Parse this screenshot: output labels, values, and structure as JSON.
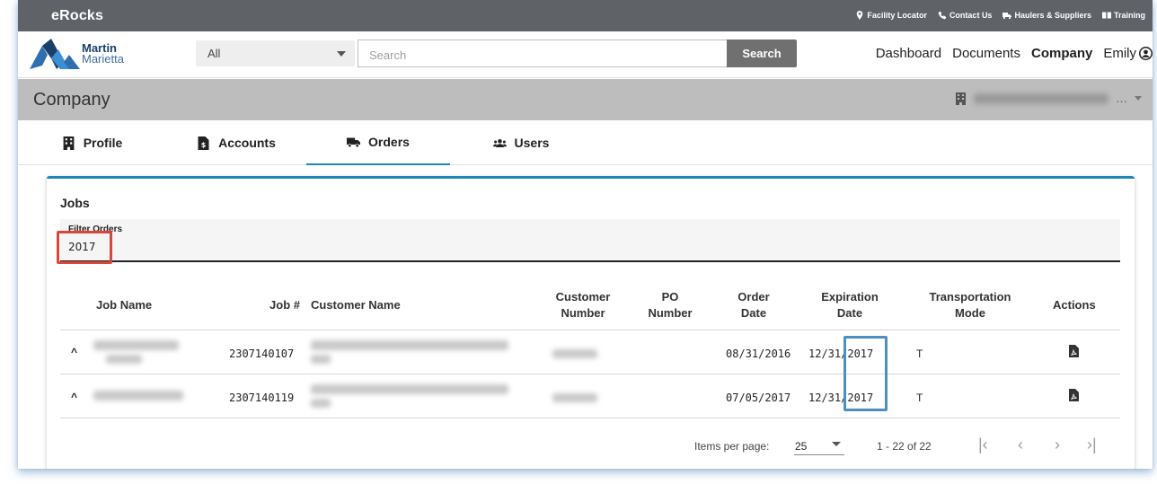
{
  "topbar": {
    "brand": "eRocks",
    "links": [
      "Facility Locator",
      "Contact Us",
      "Haulers & Suppliers",
      "Training"
    ]
  },
  "header": {
    "logo_line1": "Martin",
    "logo_line2": "Marietta",
    "select_value": "All",
    "search_placeholder": "Search",
    "search_button": "Search",
    "nav": [
      "Dashboard",
      "Documents",
      "Company",
      "Emily"
    ]
  },
  "company": {
    "title": "Company",
    "selector_suffix": "…"
  },
  "tabs": [
    {
      "label": "Profile",
      "icon": "building-icon"
    },
    {
      "label": "Accounts",
      "icon": "document-dollar-icon"
    },
    {
      "label": "Orders",
      "icon": "truck-icon"
    },
    {
      "label": "Users",
      "icon": "users-icon"
    }
  ],
  "active_tab": "Orders",
  "jobs": {
    "title": "Jobs",
    "filter_label": "Filter Orders",
    "filter_value": "2017",
    "columns": {
      "job_name": "Job Name",
      "job_number": "Job #",
      "customer_name": "Customer Name",
      "customer_number": [
        "Customer",
        "Number"
      ],
      "po_number": [
        "PO",
        "Number"
      ],
      "order_date": [
        "Order",
        "Date"
      ],
      "expiration_date": [
        "Expiration",
        "Date"
      ],
      "transportation_mode": [
        "Transportation",
        "Mode"
      ],
      "actions": "Actions"
    },
    "rows": [
      {
        "job_number": "2307140107",
        "order_date": "08/31/2016",
        "expiration_date": "12/31/2017",
        "transportation_mode": "T"
      },
      {
        "job_number": "2307140119",
        "order_date": "07/05/2017",
        "expiration_date": "12/31/2017",
        "transportation_mode": "T"
      }
    ],
    "paginator": {
      "items_label": "Items per page:",
      "page_size": "25",
      "range": "1 - 22 of 22"
    }
  },
  "colors": {
    "topbar": "#5f6368",
    "accent": "#1f87b8",
    "highlight_red": "#d9473b",
    "highlight_blue": "#4d8fbf"
  }
}
